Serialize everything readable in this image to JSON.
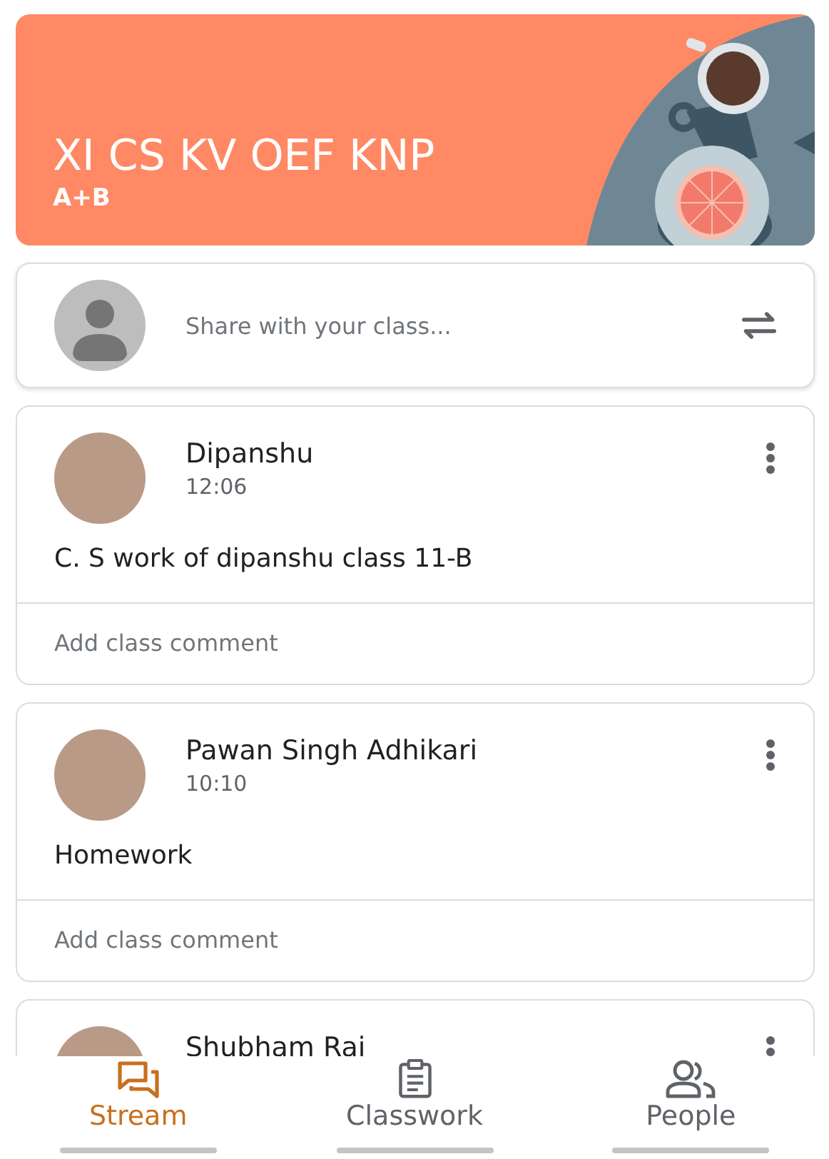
{
  "class_header": {
    "title": "XI CS KV OEF KNP",
    "subtitle": "A+B"
  },
  "share": {
    "placeholder": "Share with your class..."
  },
  "posts": [
    {
      "author": "Dipanshu",
      "time": "12:06",
      "text": "C. S work of dipanshu class 11-B",
      "comment": "Add class comment"
    },
    {
      "author": "Pawan Singh Adhikari",
      "time": "10:10",
      "text": "Homework",
      "comment": "Add class comment"
    },
    {
      "author": "Shubham Rai"
    }
  ],
  "bottom_nav": [
    {
      "label": "Stream",
      "selected": true
    },
    {
      "label": "Classwork",
      "selected": false
    },
    {
      "label": "People",
      "selected": false
    }
  ]
}
